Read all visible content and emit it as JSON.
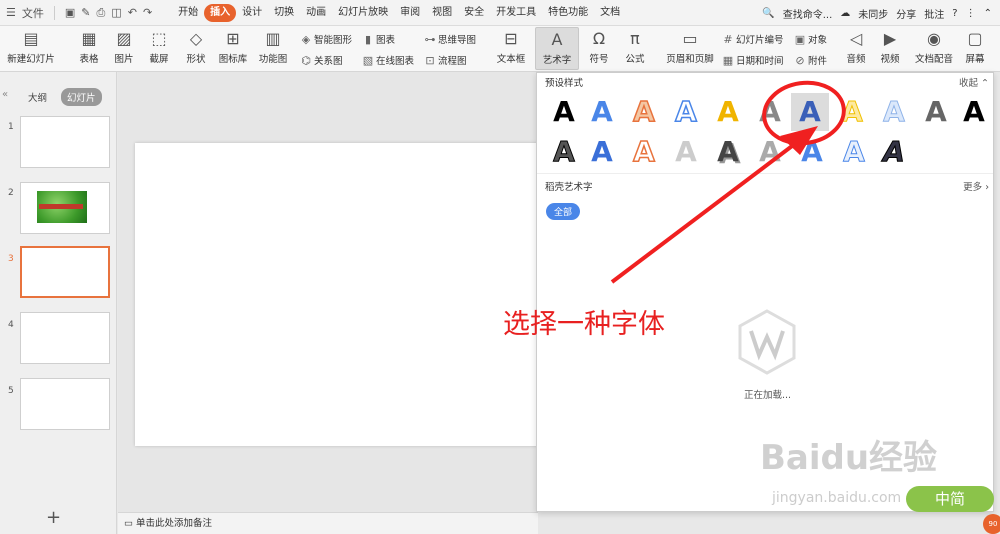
{
  "menubar": {
    "file": "文件",
    "items": [
      "开始",
      "插入",
      "设计",
      "切换",
      "动画",
      "幻灯片放映",
      "审阅",
      "视图",
      "安全",
      "开发工具",
      "特色功能",
      "文档"
    ],
    "search": "查找命令...",
    "sync": "未同步",
    "share": "分享",
    "annotate": "批注"
  },
  "ribbon": {
    "new_slide": "新建幻灯片",
    "table": "表格",
    "picture": "图片",
    "screenshot": "截屏",
    "shape": "形状",
    "icon_lib": "图标库",
    "func_chart": "功能图",
    "smart_shape": "智能图形",
    "chart": "图表",
    "relation": "关系图",
    "online_chart": "在线图表",
    "mindmap": "思维导图",
    "flowchart": "流程图",
    "textbox": "文本框",
    "wordart": "艺术字",
    "symbol": "符号",
    "formula": "公式",
    "header_footer": "页眉和页脚",
    "slide_number": "幻灯片编号",
    "object": "对象",
    "datetime": "日期和时间",
    "attachment": "附件",
    "audio": "音频",
    "video": "视频",
    "doc_voice": "文档配音",
    "screen_rec": "屏幕"
  },
  "leftpanel": {
    "tab_outline": "大纲",
    "tab_slides": "幻灯片",
    "slides": [
      "1",
      "2",
      "3",
      "4",
      "5"
    ]
  },
  "notes": "单击此处添加备注",
  "panel": {
    "preset_title": "预设样式",
    "collapse": "收起",
    "daoke_title": "稻壳艺术字",
    "more": "更多",
    "all_btn": "全部",
    "loading": "正在加载...",
    "art_letter": "A"
  },
  "annotation": "选择一种字体",
  "watermark": {
    "brand": "Baidu经验",
    "url": "jingyan.baidu.com",
    "badge": "中简",
    "badge2": "90"
  }
}
